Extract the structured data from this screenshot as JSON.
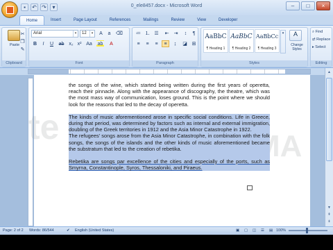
{
  "window": {
    "title": "0_ele8457.docx - Microsoft Word"
  },
  "tabs": [
    "Home",
    "Insert",
    "Page Layout",
    "References",
    "Mailings",
    "Review",
    "View",
    "Developer"
  ],
  "ribbon": {
    "clipboard": {
      "label": "Clipboard",
      "paste": "Paste"
    },
    "font": {
      "label": "Font",
      "name": "Arial",
      "size": "12"
    },
    "paragraph": {
      "label": "Paragraph"
    },
    "styles": {
      "label": "Styles",
      "tiles": [
        {
          "sample": "AaBbC",
          "name": "¶ Heading 1"
        },
        {
          "sample": "AaBbC",
          "name": "¶ Heading 2"
        },
        {
          "sample": "AaBbCc",
          "name": "¶ Heading 3"
        }
      ],
      "change_styles": "Change Styles"
    },
    "editing": {
      "label": "Editing",
      "find": "Find",
      "replace": "Replace",
      "select": "Select"
    }
  },
  "document": {
    "p1": "the songs of the wine, which started being written during the first years of operetta, reach their pinnacle. Along with the appearance of discography, the theatre, which was the most mass way of communication, loses ground. This is the point where we should look for the reasons that led to the decay of operetta.",
    "p2": "The kinds of music aforementioned arose in specific social conditions. Life in Greece, during that period, was determined by factors such as internal and external immigration, doubling of the Greek territories in 1912 and the Asia Minor Catastrophe in 1922.",
    "p3": "The refugees' songs arose from the Asia Minor Catastrophe, in combination with the folk songs, the songs of the islands and the other kinds of music aforementioned became the substratum that led to the creation of rebetika.",
    "p4": "Rebetika are songs par excellence of the cities and especially of the ports, such as Smyrna, Constantinople, Syros, Thessaloniki, and Piraeus."
  },
  "status": {
    "page": "Page: 2 of 2",
    "words": "Words: 86/544",
    "language": "English (United States)",
    "zoom": "100%"
  }
}
